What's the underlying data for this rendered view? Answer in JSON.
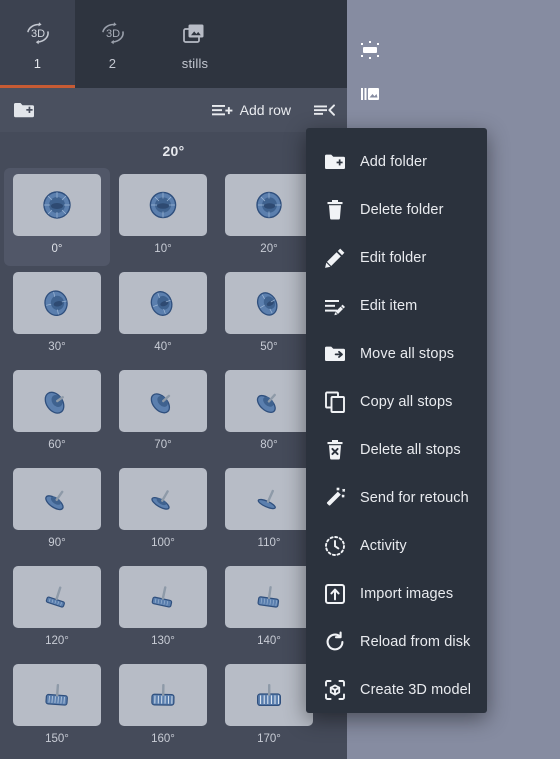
{
  "tabs": [
    {
      "label": "1",
      "icon": "rotate-3d-icon",
      "active": true
    },
    {
      "label": "2",
      "icon": "rotate-3d-icon",
      "active": false
    },
    {
      "label": "stills",
      "icon": "stacked-images-icon",
      "active": false
    }
  ],
  "toolbar": {
    "add_folder_icon": "folder-plus-icon",
    "add_row_label": "Add row",
    "add_row_icon": "list-plus-icon",
    "collapse_icon": "list-collapse-icon"
  },
  "grid": {
    "row_header": "20°",
    "selected_index": 0,
    "cells": [
      {
        "label": "0°"
      },
      {
        "label": "10°"
      },
      {
        "label": "20°"
      },
      {
        "label": "30°"
      },
      {
        "label": "40°"
      },
      {
        "label": "50°"
      },
      {
        "label": "60°"
      },
      {
        "label": "70°"
      },
      {
        "label": "80°"
      },
      {
        "label": "90°"
      },
      {
        "label": "100°"
      },
      {
        "label": "110°"
      },
      {
        "label": "120°"
      },
      {
        "label": "130°"
      },
      {
        "label": "140°"
      },
      {
        "label": "150°"
      },
      {
        "label": "160°"
      },
      {
        "label": "170°"
      }
    ]
  },
  "context_menu": {
    "items": [
      {
        "label": "Add folder",
        "icon": "folder-plus-icon"
      },
      {
        "label": "Delete folder",
        "icon": "trash-icon"
      },
      {
        "label": "Edit folder",
        "icon": "pencil-icon"
      },
      {
        "label": "Edit item",
        "icon": "list-pencil-icon"
      },
      {
        "label": "Move all stops",
        "icon": "folder-arrow-right-icon"
      },
      {
        "label": "Copy all stops",
        "icon": "copy-icon"
      },
      {
        "label": "Delete all stops",
        "icon": "trash-x-icon"
      },
      {
        "label": "Send for retouch",
        "icon": "magic-wand-icon"
      },
      {
        "label": "Activity",
        "icon": "dashed-clock-icon"
      },
      {
        "label": "Import images",
        "icon": "import-arrow-up-icon"
      },
      {
        "label": "Reload from disk",
        "icon": "refresh-icon"
      },
      {
        "label": "Create 3D model",
        "icon": "cube-brackets-icon"
      }
    ]
  },
  "right_panel": {
    "icons": [
      {
        "name": "light-panel-icon"
      },
      {
        "name": "image-layers-icon"
      },
      {
        "name": "strip-icon"
      }
    ]
  },
  "colors": {
    "accent": "#c75b34",
    "menu_bg": "#2b323d",
    "app_bg": "#454b5a",
    "toolbar_bg": "#4a505f",
    "tabbar_bg": "#2e343f",
    "right_bg": "#868ca1",
    "thumb_bg": "#b7bcc6"
  }
}
